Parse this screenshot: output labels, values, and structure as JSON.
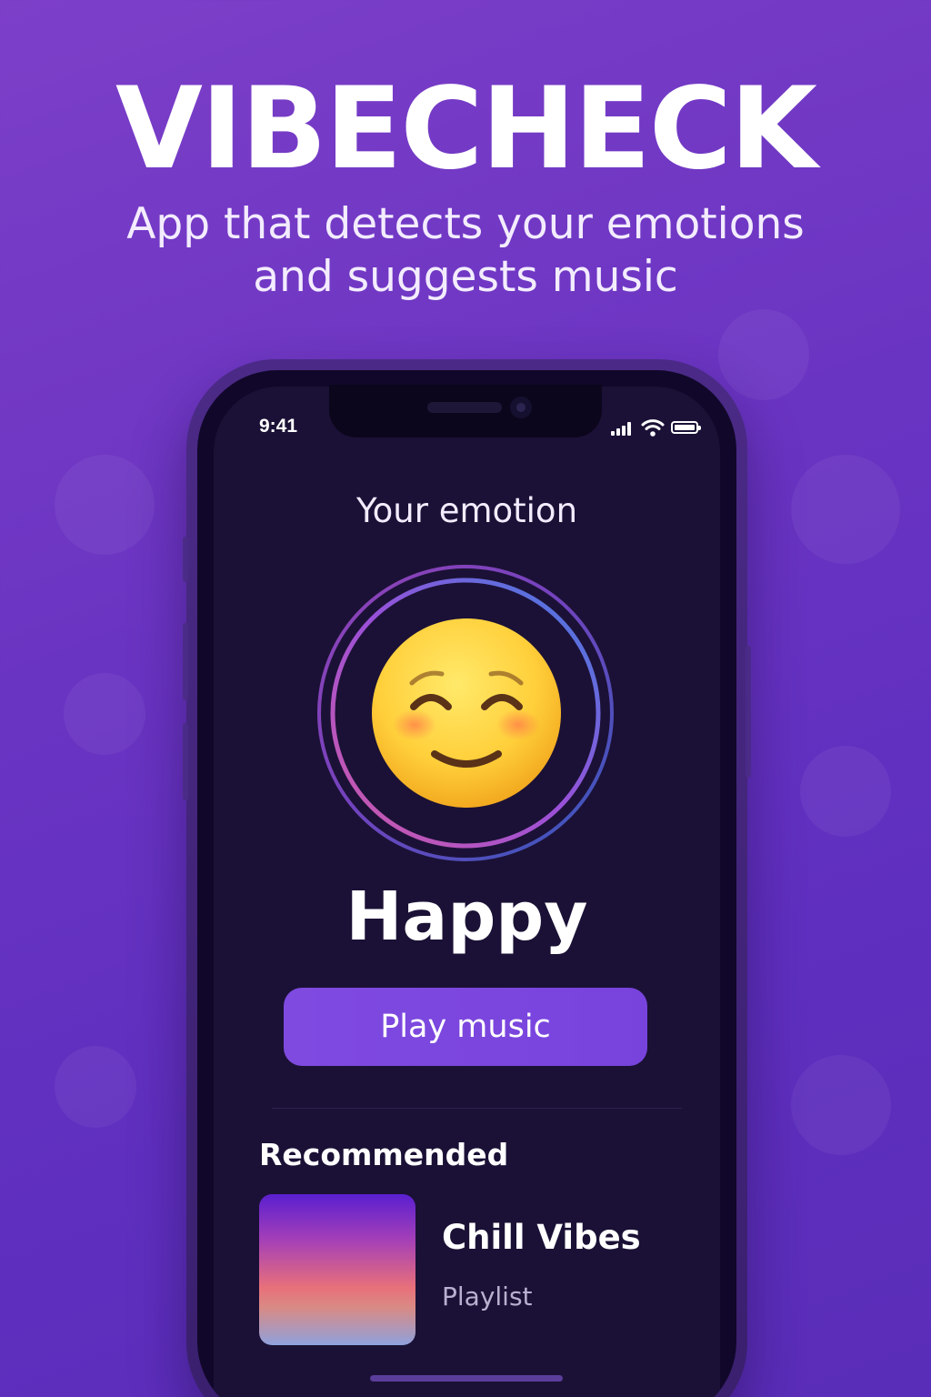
{
  "hero": {
    "title": "VIBECHECK",
    "subtitle_line1": "App that detects your emotions",
    "subtitle_line2": "and suggests music"
  },
  "status_bar": {
    "time": "9:41",
    "icons": [
      "signal-icon",
      "wifi-icon",
      "battery-icon"
    ]
  },
  "emotion": {
    "label": "Your emotion",
    "value": "Happy",
    "emoji_icon": "smiling-face-icon"
  },
  "actions": {
    "play_label": "Play music"
  },
  "recommended": {
    "heading": "Recommended",
    "items": [
      {
        "title": "Chill Vibes",
        "type": "Playlist"
      }
    ]
  },
  "colors": {
    "background": "#6a34c2",
    "screen": "#1b1136",
    "accent": "#7f4ae0"
  }
}
